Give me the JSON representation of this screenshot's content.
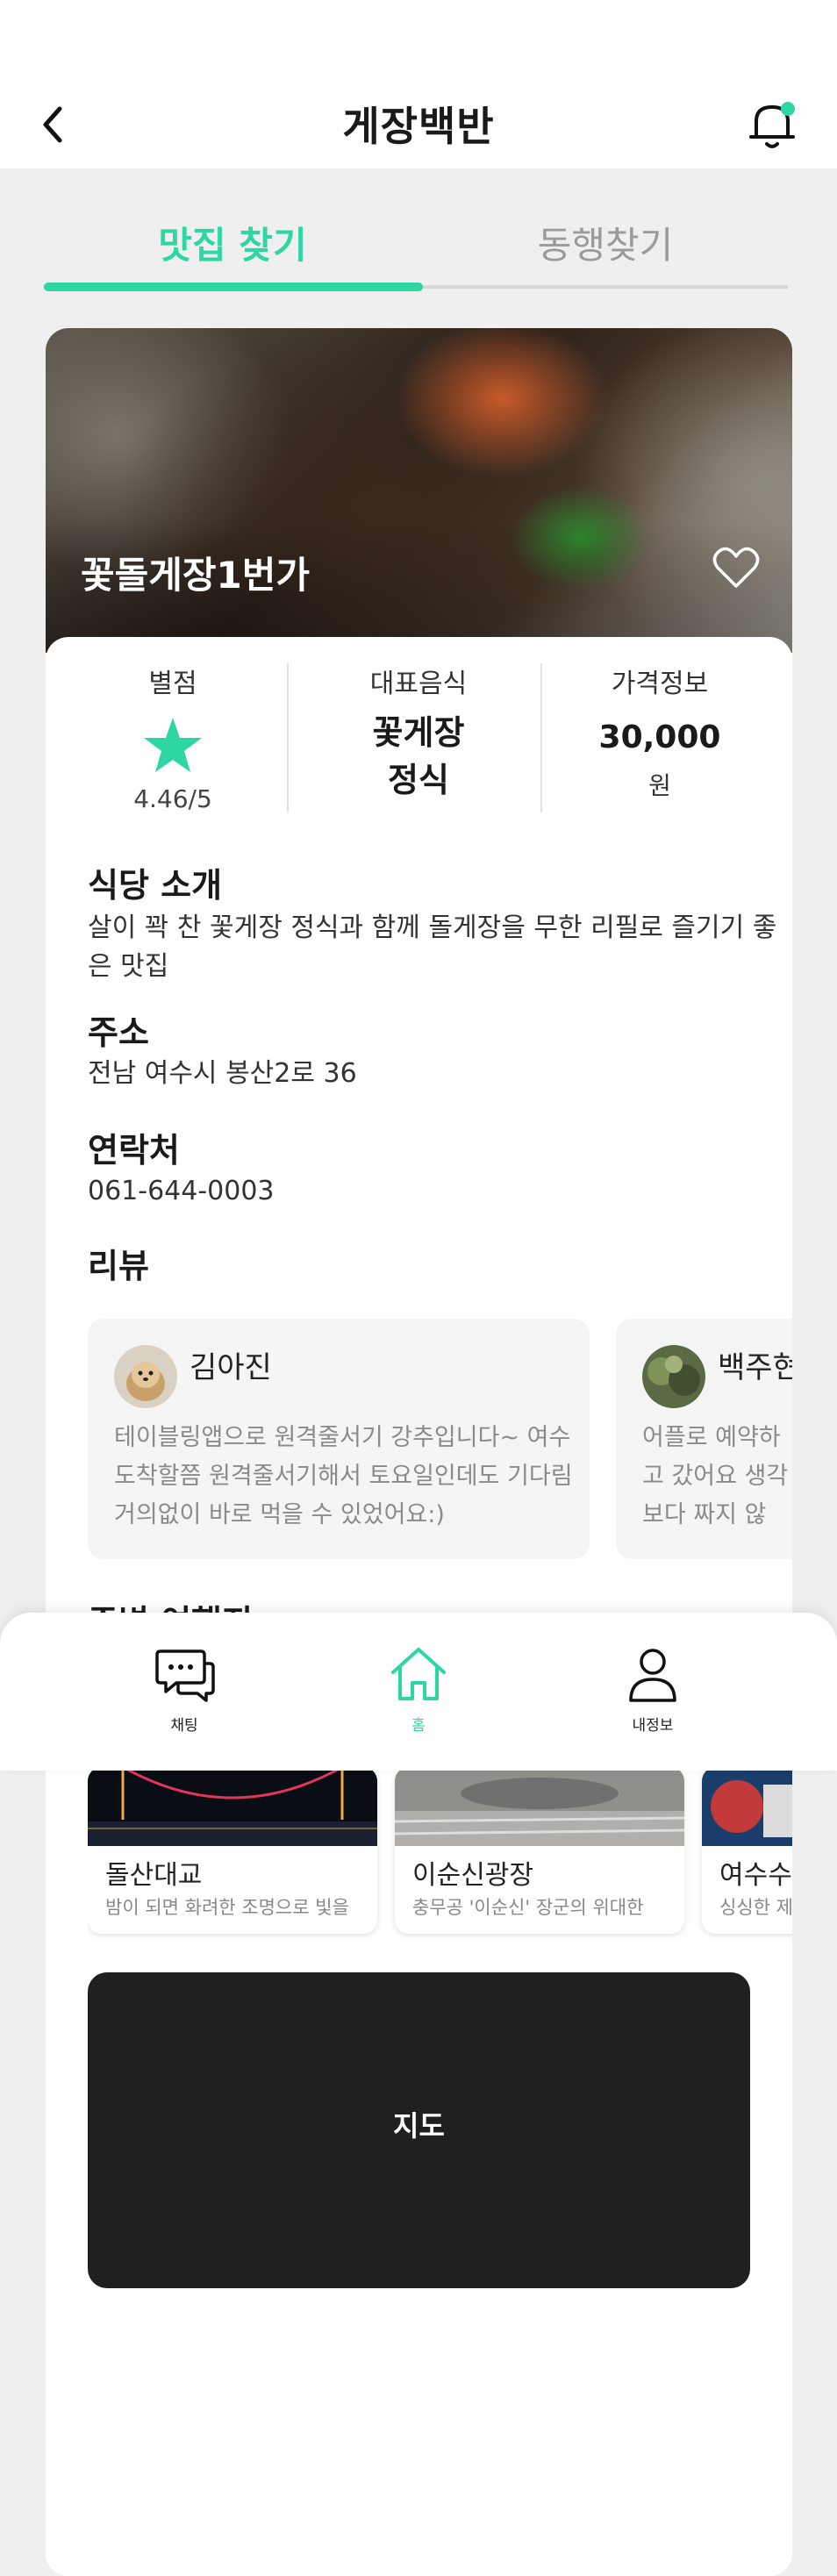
{
  "header": {
    "title": "게장백반"
  },
  "tabs": [
    {
      "label": "맛집 찾기",
      "active": true
    },
    {
      "label": "동행찾기",
      "active": false
    }
  ],
  "restaurant": {
    "name": "꽃돌게장1번가",
    "stats": {
      "rating_label": "별점",
      "rating_value": "4.46/5",
      "menu_label": "대표음식",
      "menu_value": "꽃게장\n정식",
      "price_label": "가격정보",
      "price_value": "30,000",
      "price_unit": "원"
    },
    "intro_title": "식당 소개",
    "intro_text": "살이 꽉 찬 꽃게장 정식과 함께 돌게장을 무한 리필로 즐기기 좋은 맛집",
    "address_title": "주소",
    "address_text": "전남 여수시 봉산2로 36",
    "contact_title": "연락처",
    "contact_text": "061-644-0003"
  },
  "reviews": {
    "title": "리뷰",
    "items": [
      {
        "name": "김아진",
        "text": "테이블링앱으로 원격줄서기 강추입니다~ 여수 도착할쯤 원격줄서기해서 토요일인데도 기다림 거의없이 바로 먹을 수 있었어요:)"
      },
      {
        "name": "백주현",
        "text": "어플로 예약하고 갔어요 생각보다 짜지 않"
      }
    ]
  },
  "nearby": {
    "title": "주변 여행지",
    "places": [
      {
        "name": "돌산대교",
        "desc": "밤이 되면 화려한 조명으로 빛을"
      },
      {
        "name": "이순신광장",
        "desc": "충무공 '이순신' 장군의 위대한"
      },
      {
        "name": "여수수",
        "desc": "싱싱한 제"
      }
    ]
  },
  "map": {
    "label": "지도"
  },
  "bottom_nav": [
    {
      "label": "채팅",
      "icon": "chat-icon",
      "active": false
    },
    {
      "label": "홈",
      "icon": "home-icon",
      "active": true
    },
    {
      "label": "내정보",
      "icon": "user-icon",
      "active": false
    }
  ],
  "colors": {
    "accent": "#2ed6a3",
    "background": "#efefef",
    "map": "#202020"
  }
}
